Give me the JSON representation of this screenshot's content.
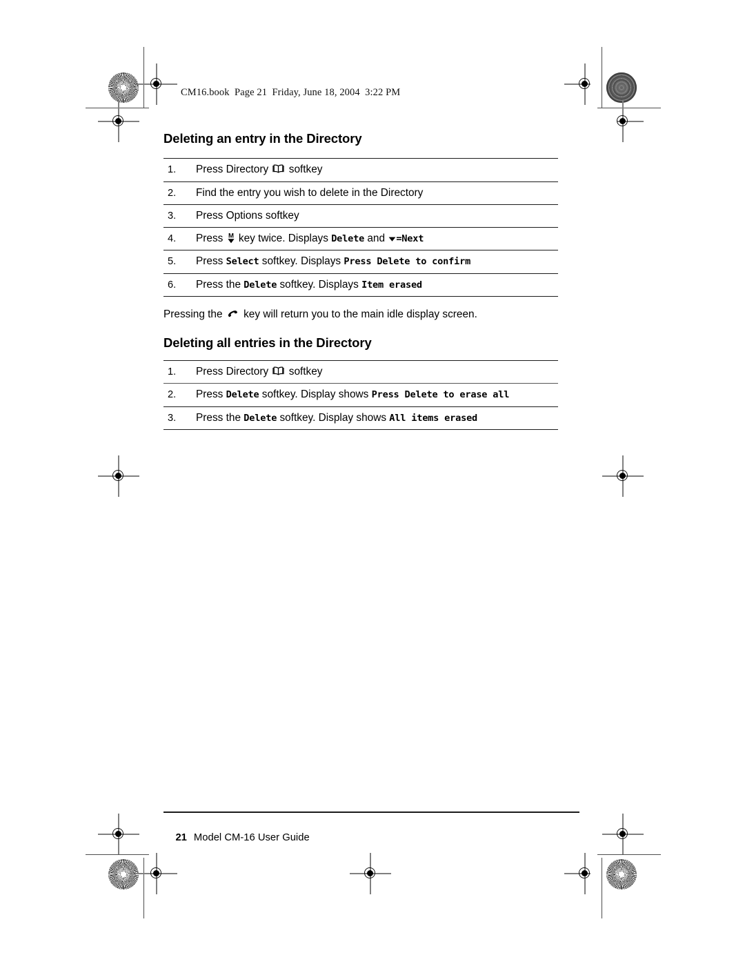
{
  "page": {
    "slug": "CM16.book  Page 21  Friday, June 18, 2004  3:22 PM"
  },
  "sections": [
    {
      "title": "Deleting an entry in the Directory",
      "steps": [
        {
          "num": "1.",
          "parts": [
            {
              "type": "text",
              "value": "Press Directory "
            },
            {
              "type": "icon",
              "value": "directory-book-icon"
            },
            {
              "type": "text",
              "value": " softkey"
            }
          ]
        },
        {
          "num": "2.",
          "parts": [
            {
              "type": "text",
              "value": "Find the entry you wish to delete in the Directory"
            }
          ]
        },
        {
          "num": "3.",
          "parts": [
            {
              "type": "text",
              "value": "Press Options softkey"
            }
          ]
        },
        {
          "num": "4.",
          "parts": [
            {
              "type": "text",
              "value": "Press "
            },
            {
              "type": "icon",
              "value": "menu-down-key-icon"
            },
            {
              "type": "text",
              "value": " key twice. Displays "
            },
            {
              "type": "lcd",
              "value": "Delete"
            },
            {
              "type": "text",
              "value": " and "
            },
            {
              "type": "lcd-tri",
              "value": "=Next"
            }
          ]
        },
        {
          "num": "5.",
          "parts": [
            {
              "type": "text",
              "value": "Press "
            },
            {
              "type": "lcd",
              "value": "Select"
            },
            {
              "type": "text",
              "value": " softkey. Displays "
            },
            {
              "type": "lcd",
              "value": "Press Delete to confirm"
            }
          ]
        },
        {
          "num": "6.",
          "parts": [
            {
              "type": "text",
              "value": "Press the "
            },
            {
              "type": "lcd",
              "value": "Delete"
            },
            {
              "type": "text",
              "value": " softkey. Displays "
            },
            {
              "type": "lcd",
              "value": "Item erased"
            }
          ]
        }
      ]
    },
    {
      "title": "Deleting all entries in the Directory",
      "steps": [
        {
          "num": "1.",
          "parts": [
            {
              "type": "text",
              "value": "Press Directory "
            },
            {
              "type": "icon",
              "value": "directory-book-icon"
            },
            {
              "type": "text",
              "value": " softkey"
            }
          ]
        },
        {
          "num": "2.",
          "parts": [
            {
              "type": "text",
              "value": "Press "
            },
            {
              "type": "lcd",
              "value": "Delete"
            },
            {
              "type": "text",
              "value": " softkey. Display shows "
            },
            {
              "type": "lcd",
              "value": "Press Delete to erase all"
            }
          ]
        },
        {
          "num": "3.",
          "parts": [
            {
              "type": "text",
              "value": "Press the "
            },
            {
              "type": "lcd",
              "value": "Delete"
            },
            {
              "type": "text",
              "value": " softkey. Display shows "
            },
            {
              "type": "lcd",
              "value": "All items erased"
            }
          ]
        }
      ]
    }
  ],
  "note": {
    "before": "Pressing the ",
    "icon": "end-call-handset-icon",
    "after": " key will return you to the main idle display screen."
  },
  "footer": {
    "page_number": "21",
    "title": "Model CM-16 User Guide"
  },
  "colors": {
    "ink": "#000000",
    "rule": "#1a1a1a",
    "trim": "#4d4d4d",
    "paper": "#ffffff"
  }
}
